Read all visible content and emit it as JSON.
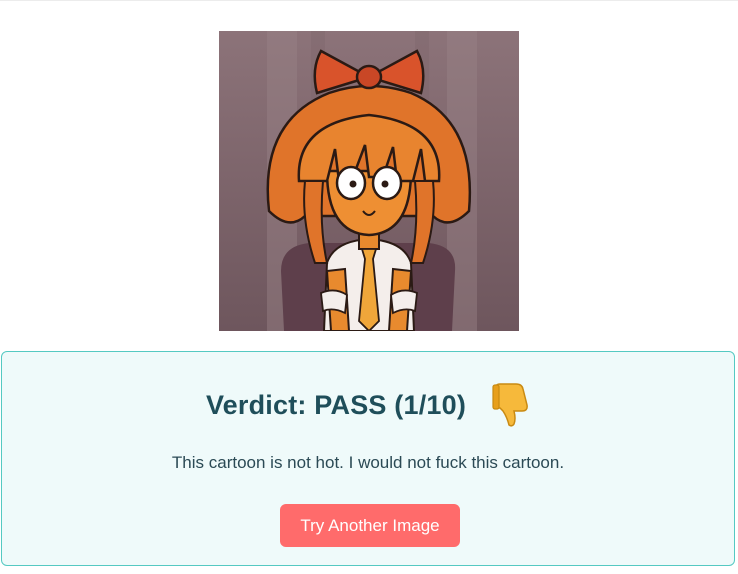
{
  "result": {
    "verdict_title": "Verdict: PASS (1/10)",
    "verdict_icon": "thumbs-down-icon",
    "verdict_text": "This cartoon is not hot. I would not fuck this cartoon.",
    "retry_label": "Try Another Image"
  },
  "colors": {
    "card_background": "#effafa",
    "card_border": "#55c9c2",
    "title_text": "#1f4e5a",
    "button": "#ff6b6b"
  }
}
